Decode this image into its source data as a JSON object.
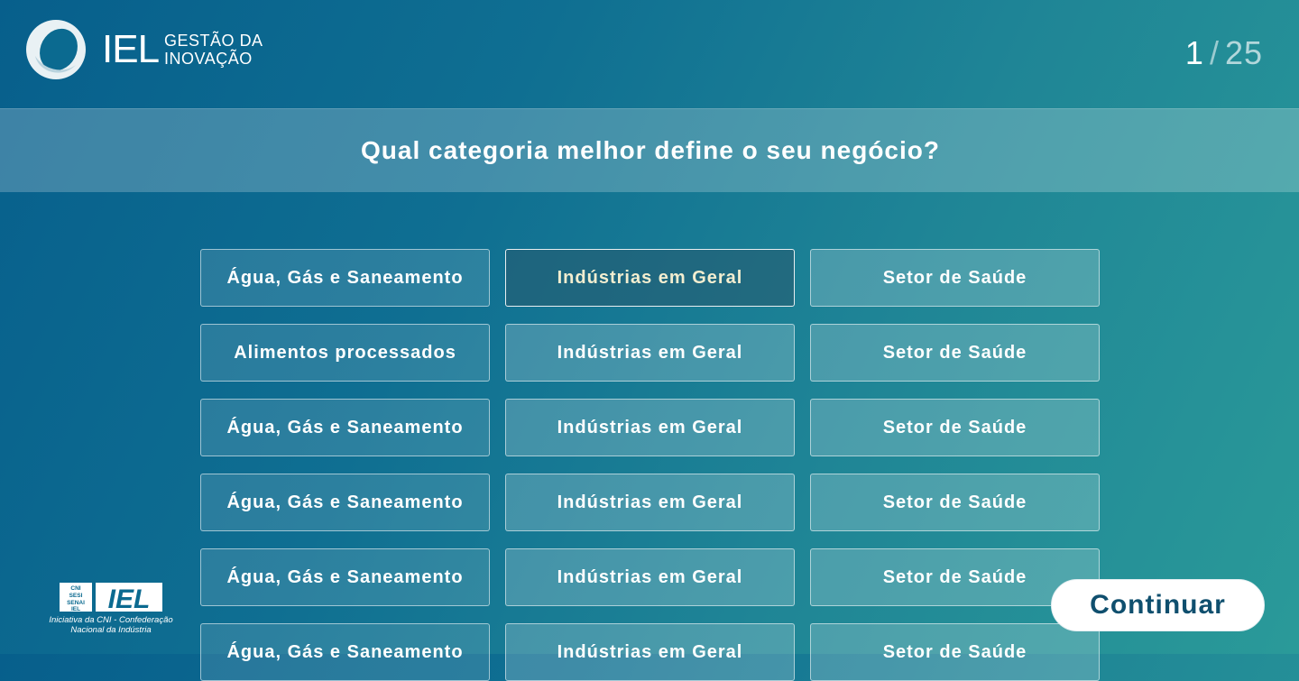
{
  "brand": {
    "name": "IEL",
    "subtitle_line1": "GESTÃO DA",
    "subtitle_line2": "INOVAÇÃO"
  },
  "progress": {
    "current": "1",
    "separator": "/",
    "total": "25"
  },
  "question": "Qual categoria melhor define o seu negócio?",
  "options": [
    [
      {
        "label": "Água, Gás e Saneamento"
      },
      {
        "label": "Indústrias em Geral",
        "selected": true
      },
      {
        "label": "Setor de Saúde"
      }
    ],
    [
      {
        "label": "Alimentos processados"
      },
      {
        "label": "Indústrias em Geral"
      },
      {
        "label": "Setor de Saúde"
      }
    ],
    [
      {
        "label": "Água, Gás e Saneamento"
      },
      {
        "label": "Indústrias em Geral"
      },
      {
        "label": "Setor de Saúde"
      }
    ],
    [
      {
        "label": "Água, Gás e Saneamento"
      },
      {
        "label": "Indústrias em Geral"
      },
      {
        "label": "Setor de Saúde"
      }
    ],
    [
      {
        "label": "Água, Gás e Saneamento"
      },
      {
        "label": "Indústrias em Geral"
      },
      {
        "label": "Setor de Saúde"
      }
    ],
    [
      {
        "label": "Água, Gás e Saneamento"
      },
      {
        "label": "Indústrias em Geral"
      },
      {
        "label": "Setor de Saúde"
      }
    ]
  ],
  "footer": {
    "logo_cni_lines": [
      "CNI",
      "SESI",
      "SENAI",
      "IEL"
    ],
    "logo_iel": "IEL",
    "caption_line1": "Iniciativa da CNI - Confederação",
    "caption_line2": "Nacional da Indústria"
  },
  "continue_label": "Continuar",
  "colors": {
    "accent_dark": "#0f4f6e",
    "selected_text": "#f3eed0"
  },
  "icons": {
    "brand_mark": "ring-logo-icon",
    "footer": "cni-iel-logo-icon"
  }
}
